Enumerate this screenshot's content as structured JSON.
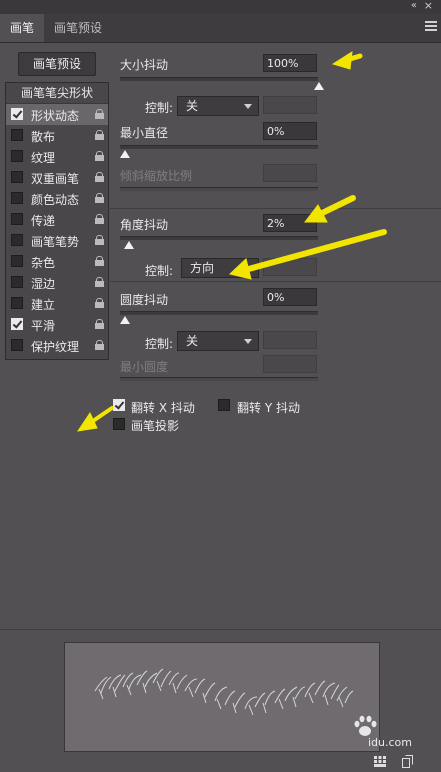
{
  "window": {
    "collapse_glyph": "«",
    "close_glyph": "×"
  },
  "tabs": [
    {
      "label": "画笔",
      "active": true
    },
    {
      "label": "画笔预设",
      "active": false
    }
  ],
  "brush_presets_button": "画笔预设",
  "left_panel": {
    "header": "画笔笔尖形状",
    "items": [
      {
        "label": "形状动态",
        "checked": true,
        "selected": true
      },
      {
        "label": "散布",
        "checked": false
      },
      {
        "label": "纹理",
        "checked": false
      },
      {
        "label": "双重画笔",
        "checked": false
      },
      {
        "label": "颜色动态",
        "checked": false
      },
      {
        "label": "传递",
        "checked": false
      },
      {
        "label": "画笔笔势",
        "checked": false
      },
      {
        "label": "杂色",
        "checked": false
      },
      {
        "label": "湿边",
        "checked": false
      },
      {
        "label": "建立",
        "checked": false
      },
      {
        "label": "平滑",
        "checked": true
      },
      {
        "label": "保护纹理",
        "checked": false
      }
    ]
  },
  "settings": {
    "size_jitter": {
      "label": "大小抖动",
      "value": "100%",
      "slider": 1.0
    },
    "size_control": {
      "label": "控制:",
      "value": "关"
    },
    "min_diameter": {
      "label": "最小直径",
      "value": "0%",
      "slider": 0.0
    },
    "tilt_scale": {
      "label": "倾斜缩放比例"
    },
    "angle_jitter": {
      "label": "角度抖动",
      "value": "2%",
      "slider": 0.02
    },
    "angle_control": {
      "label": "控制:",
      "value": "方向"
    },
    "roundness_jitter": {
      "label": "圆度抖动",
      "value": "0%",
      "slider": 0.0
    },
    "roundness_control": {
      "label": "控制:",
      "value": "关"
    },
    "min_roundness": {
      "label": "最小圆度"
    },
    "flip_x": {
      "label": "翻转 X 抖动",
      "checked": true
    },
    "flip_y": {
      "label": "翻转 Y 抖动",
      "checked": false
    },
    "brush_projection": {
      "label": "画笔投影",
      "checked": false
    }
  },
  "watermark": "idu.com",
  "colors": {
    "panel_bg": "#535053",
    "annotation_arrow": "#f2e600",
    "selected_row": "#6a676a"
  }
}
